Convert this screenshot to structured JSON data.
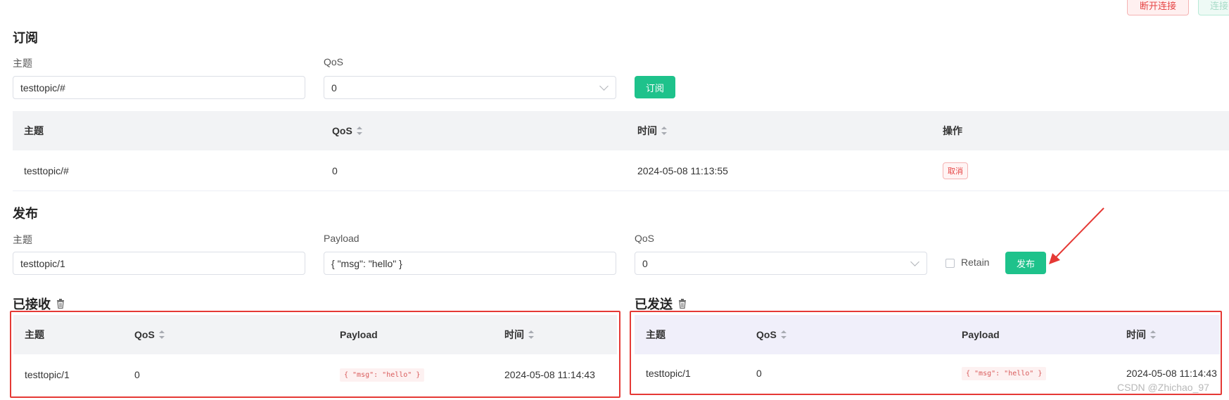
{
  "header": {
    "disconnect_label": "断开连接",
    "connect_label": "连接"
  },
  "subscribe": {
    "title": "订阅",
    "topic_label": "主题",
    "topic_value": "testtopic/#",
    "qos_label": "QoS",
    "qos_value": "0",
    "submit_label": "订阅",
    "table": {
      "headers": [
        "主题",
        "QoS",
        "时间",
        "操作"
      ],
      "rows": [
        {
          "topic": "testtopic/#",
          "qos": "0",
          "time": "2024-05-08 11:13:55",
          "action": "取消"
        }
      ]
    }
  },
  "publish": {
    "title": "发布",
    "topic_label": "主题",
    "topic_value": "testtopic/1",
    "payload_label": "Payload",
    "payload_value": "{ \"msg\": \"hello\" }",
    "qos_label": "QoS",
    "qos_value": "0",
    "retain_label": "Retain",
    "retain_checked": false,
    "submit_label": "发布"
  },
  "received": {
    "title": "已接收",
    "headers": [
      "主题",
      "QoS",
      "Payload",
      "时间"
    ],
    "rows": [
      {
        "topic": "testtopic/1",
        "qos": "0",
        "payload": "{ \"msg\": \"hello\" }",
        "time": "2024-05-08 11:14:43"
      }
    ]
  },
  "sent": {
    "title": "已发送",
    "headers": [
      "主题",
      "QoS",
      "Payload",
      "时间"
    ],
    "rows": [
      {
        "topic": "testtopic/1",
        "qos": "0",
        "payload": "{ \"msg\": \"hello\" }",
        "time": "2024-05-08 11:14:43"
      }
    ]
  },
  "watermark": "CSDN @Zhichao_97",
  "colors": {
    "accent_green": "#1ec28b",
    "danger_red": "#e53935"
  }
}
